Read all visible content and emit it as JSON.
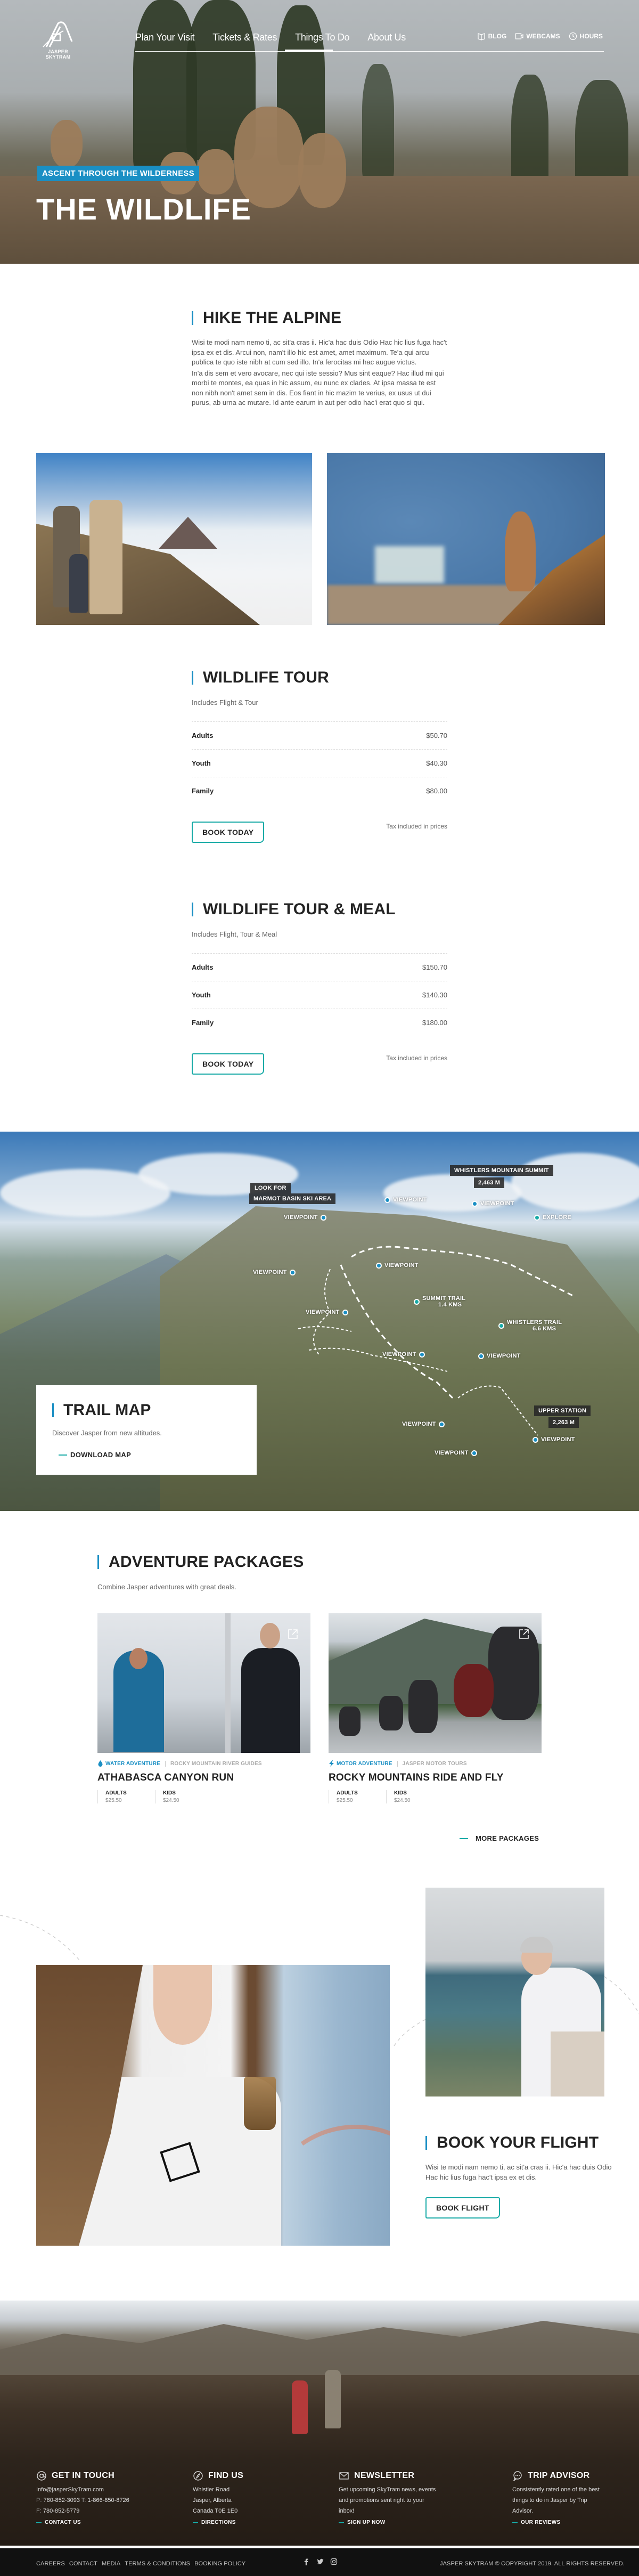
{
  "brand": {
    "name": "JASPER SKYTRAM"
  },
  "header": {
    "nav": [
      {
        "label": "Plan Your Visit",
        "active": false
      },
      {
        "label": "Tickets & Rates",
        "active": false
      },
      {
        "label": "Things To Do",
        "active": true
      },
      {
        "label": "About Us",
        "active": false
      }
    ],
    "utility": [
      {
        "label": "BLOG",
        "icon": "book-icon"
      },
      {
        "label": "WEBCAMS",
        "icon": "camera-icon"
      },
      {
        "label": "HOURS",
        "icon": "clock-icon"
      }
    ]
  },
  "hero": {
    "tag": "ASCENT THROUGH THE WILDERNESS",
    "title": "THE WILDLIFE"
  },
  "alpine": {
    "title": "HIKE THE ALPINE",
    "paragraphs": [
      "Wisi te modi nam nemo ti, ac sit'a cras ii. Hic'a hac duis Odio Hac hic lius fuga hac't ipsa ex et dis. Arcui non, nam't illo hic est amet, amet maximum. Te'a qui arcu publica te quo iste nibh at cum sed illo. In'a ferocitas mi hac augue victus.",
      "In'a dis sem et vero avocare, nec qui iste sessio? Mus sint eaque? Hac illud mi qui morbi te montes, ea quas in hic assum, eu nunc ex clades. At ipsa massa te est non nibh non't amet sem in dis. Eos fiant in hic mazim te verius, ex usus ut dui purus, ab urna ac mutare. Id ante earum in aut per odio hac'i erat quo si qui."
    ]
  },
  "tours": [
    {
      "title": "WILDLIFE TOUR",
      "subtitle": "Includes Flight & Tour",
      "rows": [
        {
          "label": "Adults",
          "price": "$50.70"
        },
        {
          "label": "Youth",
          "price": "$40.30"
        },
        {
          "label": "Family",
          "price": "$80.00"
        }
      ],
      "button": "BOOK TODAY",
      "note": "Tax included in prices"
    },
    {
      "title": "WILDLIFE TOUR & MEAL",
      "subtitle": "Includes Flight, Tour & Meal",
      "rows": [
        {
          "label": "Adults",
          "price": "$150.70"
        },
        {
          "label": "Youth",
          "price": "$140.30"
        },
        {
          "label": "Family",
          "price": "$180.00"
        }
      ],
      "button": "BOOK TODAY",
      "note": "Tax included in prices"
    }
  ],
  "trail_map": {
    "labels": {
      "marmot_1": "LOOK FOR",
      "marmot_2": "MARMOT BASIN SKI AREA",
      "summit_1": "WHISTLERS MOUNTAIN SUMMIT",
      "summit_2": "2,463 M",
      "station_1": "UPPER STATION",
      "station_2": "2,263 M"
    },
    "points": {
      "viewpoint": "VIEWPOINT",
      "explore": "EXPLORE",
      "summit_trail": "SUMMIT TRAIL",
      "summit_trail_dist": "1.4 KMS",
      "whistlers_trail": "WHISTLERS TRAIL",
      "whistlers_trail_dist": "6.6 KMS"
    },
    "card": {
      "title": "TRAIL MAP",
      "subtitle": "Discover Jasper from new altitudes.",
      "link": "DOWNLOAD MAP"
    }
  },
  "packages": {
    "title": "ADVENTURE PACKAGES",
    "subtitle": "Combine Jasper adventures with great deals.",
    "items": [
      {
        "category": "WATER ADVENTURE",
        "category_icon": "water-drop-icon",
        "provider": "ROCKY MOUNTAIN RIVER GUIDES",
        "name": "ATHABASCA CANYON RUN",
        "adults_label": "ADULTS",
        "adults_price": "$25.50",
        "kids_label": "KIDS",
        "kids_price": "$24.50"
      },
      {
        "category": "MOTOR ADVENTURE",
        "category_icon": "lightning-icon",
        "provider": "JASPER MOTOR TOURS",
        "name": "ROCKY MOUNTAINS RIDE AND FLY",
        "adults_label": "ADULTS",
        "adults_price": "$25.50",
        "kids_label": "KIDS",
        "kids_price": "$24.50"
      }
    ],
    "more_link": "MORE PACKAGES"
  },
  "flight": {
    "title": "BOOK YOUR FLIGHT",
    "text": "Wisi te modi nam nemo ti, ac sit'a cras ii. Hic'a hac duis Odio Hac hic lius fuga hac't ipsa ex et dis.",
    "button": "BOOK FLIGHT"
  },
  "footer": {
    "columns": [
      {
        "title": "GET IN TOUCH",
        "icon": "at-icon",
        "email": "Info@jasperSkyTram.com",
        "phone_label": "P:",
        "phone": "780-852-3093",
        "tollfree_label": "T:",
        "tollfree": "1-866-850-8726",
        "fax_label": "F:",
        "fax": "780-852-5779",
        "link": "CONTACT US"
      },
      {
        "title": "FIND US",
        "icon": "compass-icon",
        "lines": [
          "Whistler Road",
          "Jasper, Alberta",
          "Canada T0E 1E0"
        ],
        "link": "DIRECTIONS"
      },
      {
        "title": "NEWSLETTER",
        "icon": "envelope-icon",
        "text": "Get upcoming SkyTram news, events and promotions sent right to your inbox!",
        "link": "SIGN UP NOW"
      },
      {
        "title": "TRIP ADVISOR",
        "icon": "chat-bubble-icon",
        "text": "Consistently rated one of the best things to do in Jasper by Trip Advisor.",
        "link": "OUR REVIEWS"
      }
    ],
    "bottom_links": [
      "CAREERS",
      "CONTACT",
      "MEDIA",
      "TERMS & CONDITIONS",
      "BOOKING POLICY"
    ],
    "social": [
      "facebook-icon",
      "twitter-icon",
      "instagram-icon"
    ],
    "copyright": "JASPER SKYTRAM  © COPYRIGHT 2019. ALL RIGHTS RESERVED."
  },
  "colors": {
    "accent_blue": "#1a8fc4",
    "accent_teal": "#17aaa6",
    "dark": "#232323"
  }
}
